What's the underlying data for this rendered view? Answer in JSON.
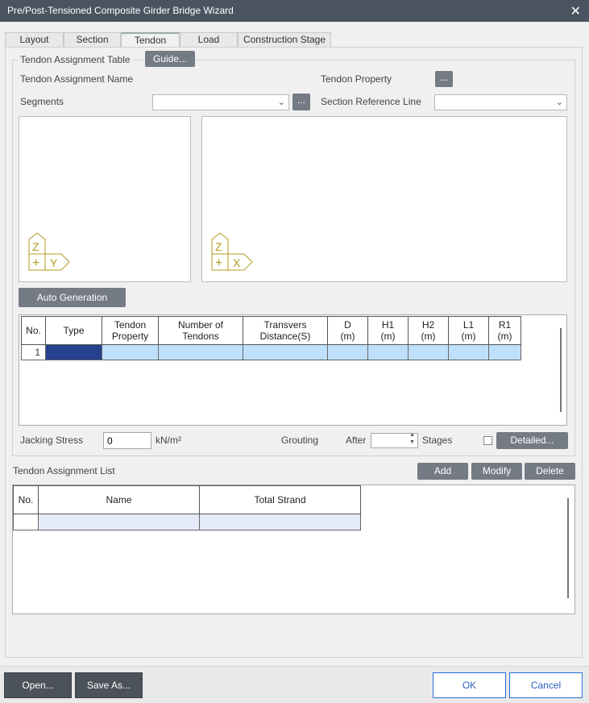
{
  "window": {
    "title": "Pre/Post-Tensioned Composite Girder Bridge Wizard"
  },
  "tabs": [
    "Layout",
    "Section",
    "Tendon",
    "Load",
    "Construction Stage"
  ],
  "assignment_table": {
    "group_title": "Tendon Assignment Table",
    "guide_button": "Guide...",
    "name_label": "Tendon Assignment Name",
    "property_label": "Tendon Property",
    "property_button": "...",
    "segments_label": "Segments",
    "segments_value": "",
    "segments_button": "...",
    "section_ref_label": "Section Reference Line",
    "section_ref_value": "",
    "auto_generation_button": "Auto Generation",
    "axes_left": {
      "vertical": "Z",
      "horizontal": "Y",
      "origin": "+"
    },
    "axes_right": {
      "vertical": "Z",
      "horizontal": "X",
      "origin": "+"
    },
    "columns": [
      {
        "l1": "No.",
        "l2": ""
      },
      {
        "l1": "Type",
        "l2": ""
      },
      {
        "l1": "Tendon",
        "l2": "Property"
      },
      {
        "l1": "Number of",
        "l2": "Tendons"
      },
      {
        "l1": "Transvers",
        "l2": "Distance(S)"
      },
      {
        "l1": "D",
        "l2": "(m)"
      },
      {
        "l1": "H1",
        "l2": "(m)"
      },
      {
        "l1": "H2",
        "l2": "(m)"
      },
      {
        "l1": "L1",
        "l2": "(m)"
      },
      {
        "l1": "R1",
        "l2": "(m)"
      }
    ],
    "row_number": "1"
  },
  "jacking": {
    "label": "Jacking Stress",
    "value": "0",
    "unit": "kN/m²",
    "grouting_label": "Grouting",
    "after_label": "After",
    "after_value": "",
    "stages_label": "Stages",
    "detailed_button": "Detailed..."
  },
  "assignment_list": {
    "title": "Tendon Assignment List",
    "add_button": "Add",
    "modify_button": "Modify",
    "delete_button": "Delete",
    "columns": [
      "No.",
      "Name",
      "Total Strand"
    ]
  },
  "footer": {
    "open_button": "Open...",
    "save_as_button": "Save As...",
    "ok_button": "OK",
    "cancel_button": "Cancel"
  }
}
